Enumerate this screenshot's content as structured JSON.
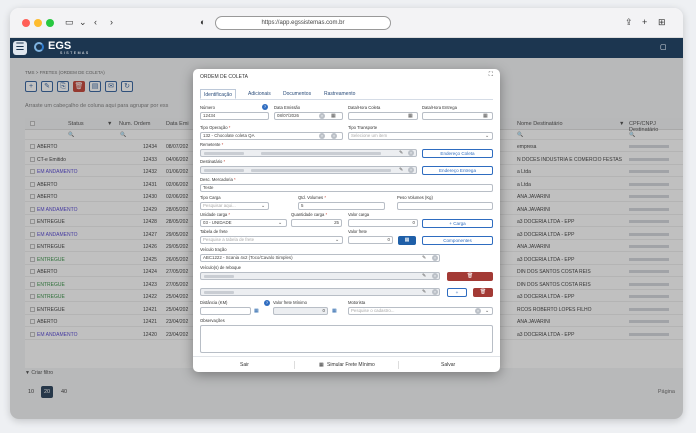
{
  "browser": {
    "url": "https://app.egssistemas.com.br"
  },
  "app": {
    "logo": "EGS",
    "logo_sub": "SISTEMAS"
  },
  "page": {
    "breadcrumb": "TMS  >  FRETES (ORDEM DE COLETA)",
    "group_hint": "Arraste um cabeçalho de coluna aqui para agrupar por ess",
    "columns": [
      "Status",
      "Num. Ordem",
      "Data Emi",
      "Nome Destinatário",
      "CPF/CNPJ Destinatário"
    ],
    "rows": [
      {
        "status": "ABERTO",
        "num": "12434",
        "date": "08/07/202",
        "dest": "empresa",
        "color": "#333"
      },
      {
        "status": "CT-e Emitido",
        "num": "12433",
        "date": "04/06/202",
        "dest": "N DOCES INDUSTRIA E COMERCIO FESTAS",
        "color": "#333"
      },
      {
        "status": "EM ANDAMENTO",
        "num": "12432",
        "date": "01/06/202",
        "dest": "a Ltda",
        "color": "#4a3ad0"
      },
      {
        "status": "ABERTO",
        "num": "12431",
        "date": "02/06/202",
        "dest": "a Ltda",
        "color": "#333"
      },
      {
        "status": "ABERTO",
        "num": "12430",
        "date": "02/06/202",
        "dest": "ANA JAVARINI",
        "color": "#333"
      },
      {
        "status": "EM ANDAMENTO",
        "num": "12429",
        "date": "28/05/202",
        "dest": "ANA JAVARINI",
        "color": "#4a3ad0"
      },
      {
        "status": "ENTREGUE",
        "num": "12428",
        "date": "28/05/202",
        "dest": "a3 DOCERIA LTDA - EPP",
        "color": "#333"
      },
      {
        "status": "EM ANDAMENTO",
        "num": "12427",
        "date": "29/05/202",
        "dest": "a3 DOCERIA LTDA - EPP",
        "color": "#4a3ad0"
      },
      {
        "status": "ENTREGUE",
        "num": "12426",
        "date": "29/05/202",
        "dest": "ANA JAVARINI",
        "color": "#333"
      },
      {
        "status": "ENTREGUE",
        "num": "12425",
        "date": "26/05/202",
        "dest": "a3 DOCERIA LTDA - EPP",
        "color": "#2a8a3a"
      },
      {
        "status": "ABERTO",
        "num": "12424",
        "date": "27/05/202",
        "dest": "DIN DOS SANTOS COSTA REIS",
        "color": "#333"
      },
      {
        "status": "ENTREGUE",
        "num": "12423",
        "date": "27/05/202",
        "dest": "DIN DOS SANTOS COSTA REIS",
        "color": "#2a8a3a"
      },
      {
        "status": "ENTREGUE",
        "num": "12422",
        "date": "25/04/202",
        "dest": "a3 DOCERIA LTDA - EPP",
        "color": "#2a8a3a"
      },
      {
        "status": "ENTREGUE",
        "num": "12421",
        "date": "25/04/202",
        "dest": "RCOS ROBERTO LOPES FILHO",
        "color": "#333"
      },
      {
        "status": "ABERTO",
        "num": "12421",
        "date": "23/04/202",
        "dest": "ANA JAVARINI",
        "color": "#333"
      },
      {
        "status": "EM ANDAMENTO",
        "num": "12420",
        "date": "23/04/202",
        "dest": "a3 DOCERIA LTDA - EPP",
        "color": "#4a3ad0"
      }
    ],
    "filter_label": "Criar filtro",
    "pages": [
      "10",
      "20",
      "40"
    ],
    "page_label": "Página"
  },
  "modal": {
    "title": "ORDEM DE COLETA",
    "tabs": [
      "Identificação",
      "Adicionais",
      "Documentos",
      "Rastreamento"
    ],
    "labels": {
      "numero": "Número",
      "data_emissao": "Data Emissão",
      "data_coleta": "Data/Hora Coleta",
      "data_entrega": "Data/Hora Entrega",
      "tipo_operacao": "Tipo Operação",
      "tipo_transporte": "Tipo Transporte",
      "remetente": "Remetente",
      "destinatario": "Destinatário",
      "desc_mercadoria": "Desc. Mercadoria",
      "tipo_carga": "Tipo Carga",
      "qtd_volumes": "Qtd. Volumes",
      "peso_volumes": "Peso Volumes (Kg)",
      "unidade_carga": "Unidade carga",
      "quantidade_carga": "Quantidade carga",
      "valor_carga": "Valor carga",
      "tabela_frete": "Tabela de frete",
      "valor_frete": "Valor frete",
      "veiculo_tracao": "Veículo tração",
      "veiculos_reboque": "Veículo(s) de reboque",
      "distancia": "Distância (KM)",
      "valor_frete_minimo": "Valor frete Mínimo",
      "motorista": "Motorista",
      "observacoes": "Observações"
    },
    "values": {
      "numero": "12434",
      "data_emissao": "08/07/2026",
      "tipo_operacao": "132 - Chocolate coleta QA",
      "tipo_transporte_ph": "Selecione um item",
      "desc_mercadoria": "Teste",
      "tipo_carga_ph": "Pesquisar aqui...",
      "qtd_volumes": "5",
      "unidade_carga": "03 - UNIDADE",
      "quantidade_carga": "25",
      "valor_carga": "0",
      "tabela_frete_ph": "Pesquise a tabela de frete",
      "valor_frete": "0",
      "veiculo_tracao": "ABC1222 - Scania 4x2 (Toco/Cavalo Simples)",
      "valor_frete_minimo": "0",
      "motorista_ph": "Pesquise o cadastro..."
    },
    "buttons": {
      "endereco_coleta": "Endereço Coleta",
      "endereco_entrega": "Endereço Entrega",
      "carga": "+ Carga",
      "componentes": "Componentes",
      "add_reboque": "+"
    },
    "footer": {
      "exit": "Sair",
      "simulate": "Simular Frete Mínimo",
      "save": "Salvar"
    }
  }
}
